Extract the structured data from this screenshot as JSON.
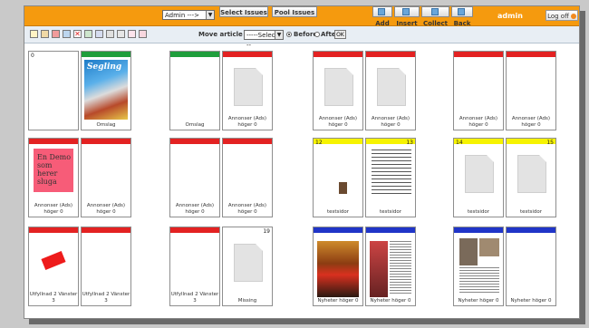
{
  "header": {
    "admin_select": "Admin --->",
    "select_issues": "Select Issues",
    "pool_issues": "Pool Issues",
    "add": "Add",
    "insert": "Insert",
    "collect": "Collect",
    "back": "Back",
    "user": "admin",
    "logoff": "Log off"
  },
  "toolbar": {
    "move_label": "Move article to",
    "select_placeholder": "-----Select----",
    "before": "Before",
    "after": "After",
    "ok": "OK"
  },
  "pages": [
    {
      "num": "0",
      "label": "",
      "bar": "none",
      "content": "blank"
    },
    {
      "num": "",
      "label": "Omslag",
      "bar": "green",
      "content": "cover",
      "cover_title": "Segling"
    },
    {
      "num": "",
      "label": "Omslag",
      "bar": "green",
      "content": "blank"
    },
    {
      "num": "",
      "label": "Annonser (Ads) höger 0",
      "bar": "red",
      "content": "doc"
    },
    {
      "num": "",
      "label": "Annonser (Ads) höger 0",
      "bar": "red",
      "content": "doc"
    },
    {
      "num": "",
      "label": "Annonser (Ads) höger 0",
      "bar": "red",
      "content": "doc"
    },
    {
      "num": "",
      "label": "Annonser (Ads) höger 0",
      "bar": "red",
      "content": "blank"
    },
    {
      "num": "",
      "label": "Annonser (Ads) höger 0",
      "bar": "red",
      "content": "blank"
    },
    {
      "num": "",
      "label": "Annonser (Ads) höger 0",
      "bar": "red",
      "content": "pink",
      "ad_text": "En Demo som herer sluga"
    },
    {
      "num": "",
      "label": "Annonser (Ads) höger 0",
      "bar": "red",
      "content": "blank"
    },
    {
      "num": "",
      "label": "Annonser (Ads) höger 0",
      "bar": "red",
      "content": "blank"
    },
    {
      "num": "",
      "label": "Annonser (Ads) höger 0",
      "bar": "red",
      "content": "blank"
    },
    {
      "num": "12",
      "label": "testsidor",
      "bar": "yellow",
      "content": "photo-small"
    },
    {
      "num": "13",
      "label": "testsidor",
      "bar": "yellow",
      "content": "textpage"
    },
    {
      "num": "14",
      "label": "testsidor",
      "bar": "yellow",
      "content": "doc"
    },
    {
      "num": "15",
      "label": "testsidor",
      "bar": "yellow",
      "content": "doc"
    },
    {
      "num": "",
      "label": "Utfyllnad 2 Vänster 3",
      "bar": "red",
      "content": "redrect"
    },
    {
      "num": "",
      "label": "Utfyllnad 2 Vänster 3",
      "bar": "red",
      "content": "blank"
    },
    {
      "num": "",
      "label": "Utfyllnad 2 Vänster 3",
      "bar": "red",
      "content": "blank"
    },
    {
      "num": "19",
      "label": "Missing",
      "bar": "none",
      "content": "doc"
    },
    {
      "num": "",
      "label": "Nyheter höger 0",
      "bar": "blue",
      "content": "fire"
    },
    {
      "num": "",
      "label": "Nyheter höger 0",
      "bar": "blue",
      "content": "news2"
    },
    {
      "num": "",
      "label": "Nyheter höger 0",
      "bar": "blue",
      "content": "news3"
    },
    {
      "num": "",
      "label": "Nyheter höger 0",
      "bar": "blue",
      "content": "blank"
    }
  ],
  "colors": {
    "topbar": "#f59a0e",
    "green": "#1f9e3c",
    "red": "#e32222",
    "yellow": "#f6f300",
    "blue": "#2035c8"
  }
}
